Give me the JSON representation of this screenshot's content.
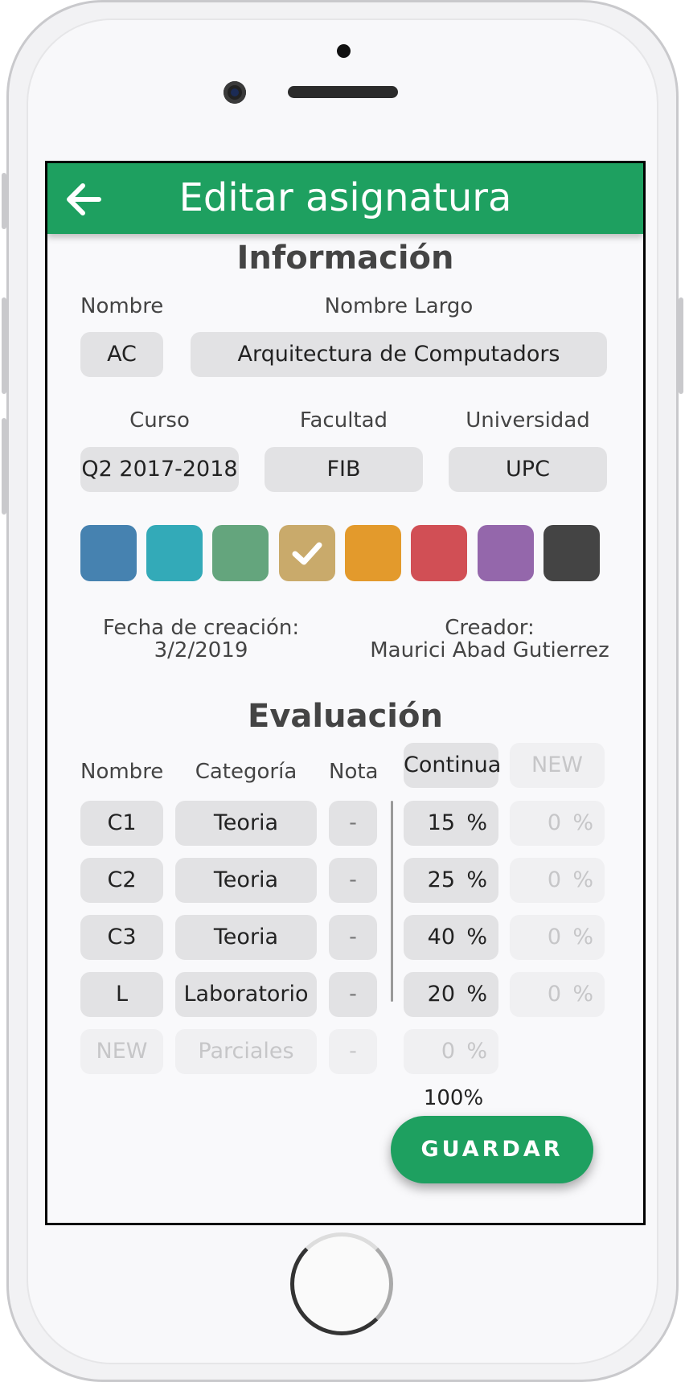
{
  "header": {
    "title": "Editar asignatura",
    "back_icon": "arrow-left-icon"
  },
  "info": {
    "heading": "Información",
    "nombre_label": "Nombre",
    "nombre_value": "AC",
    "nombre_largo_label": "Nombre Largo",
    "nombre_largo_value": "Arquitectura de Computadors",
    "curso_label": "Curso",
    "curso_value": "Q2 2017-2018",
    "facultad_label": "Facultad",
    "facultad_value": "FIB",
    "universidad_label": "Universidad",
    "universidad_value": "UPC",
    "colors": [
      "#4682b0",
      "#33aab8",
      "#64a57d",
      "#c9aa6b",
      "#e39a2c",
      "#d14f55",
      "#9467ab",
      "#444444"
    ],
    "selected_color_index": 3,
    "fecha_label": "Fecha de creación:",
    "fecha_value": "3/2/2019",
    "creador_label": "Creador:",
    "creador_value": "Maurici Abad Gutierrez"
  },
  "evaluacion": {
    "heading": "Evaluación",
    "col_nombre": "Nombre",
    "col_categoria": "Categoría",
    "col_nota": "Nota",
    "col_continua": "Continua",
    "col_new": "NEW",
    "rows": [
      {
        "nombre": "C1",
        "categoria": "Teoria",
        "nota": "-",
        "continua": "15",
        "pct": "%",
        "new_value": "0",
        "new_pct": "%"
      },
      {
        "nombre": "C2",
        "categoria": "Teoria",
        "nota": "-",
        "continua": "25",
        "pct": "%",
        "new_value": "0",
        "new_pct": "%"
      },
      {
        "nombre": "C3",
        "categoria": "Teoria",
        "nota": "-",
        "continua": "40",
        "pct": "%",
        "new_value": "0",
        "new_pct": "%"
      },
      {
        "nombre": "L",
        "categoria": "Laboratorio",
        "nota": "-",
        "continua": "20",
        "pct": "%",
        "new_value": "0",
        "new_pct": "%"
      }
    ],
    "new_row": {
      "nombre": "NEW",
      "categoria": "Parciales",
      "nota": "-",
      "continua": "0",
      "pct": "%"
    },
    "total": "100%"
  },
  "save_button": "GUARDAR"
}
